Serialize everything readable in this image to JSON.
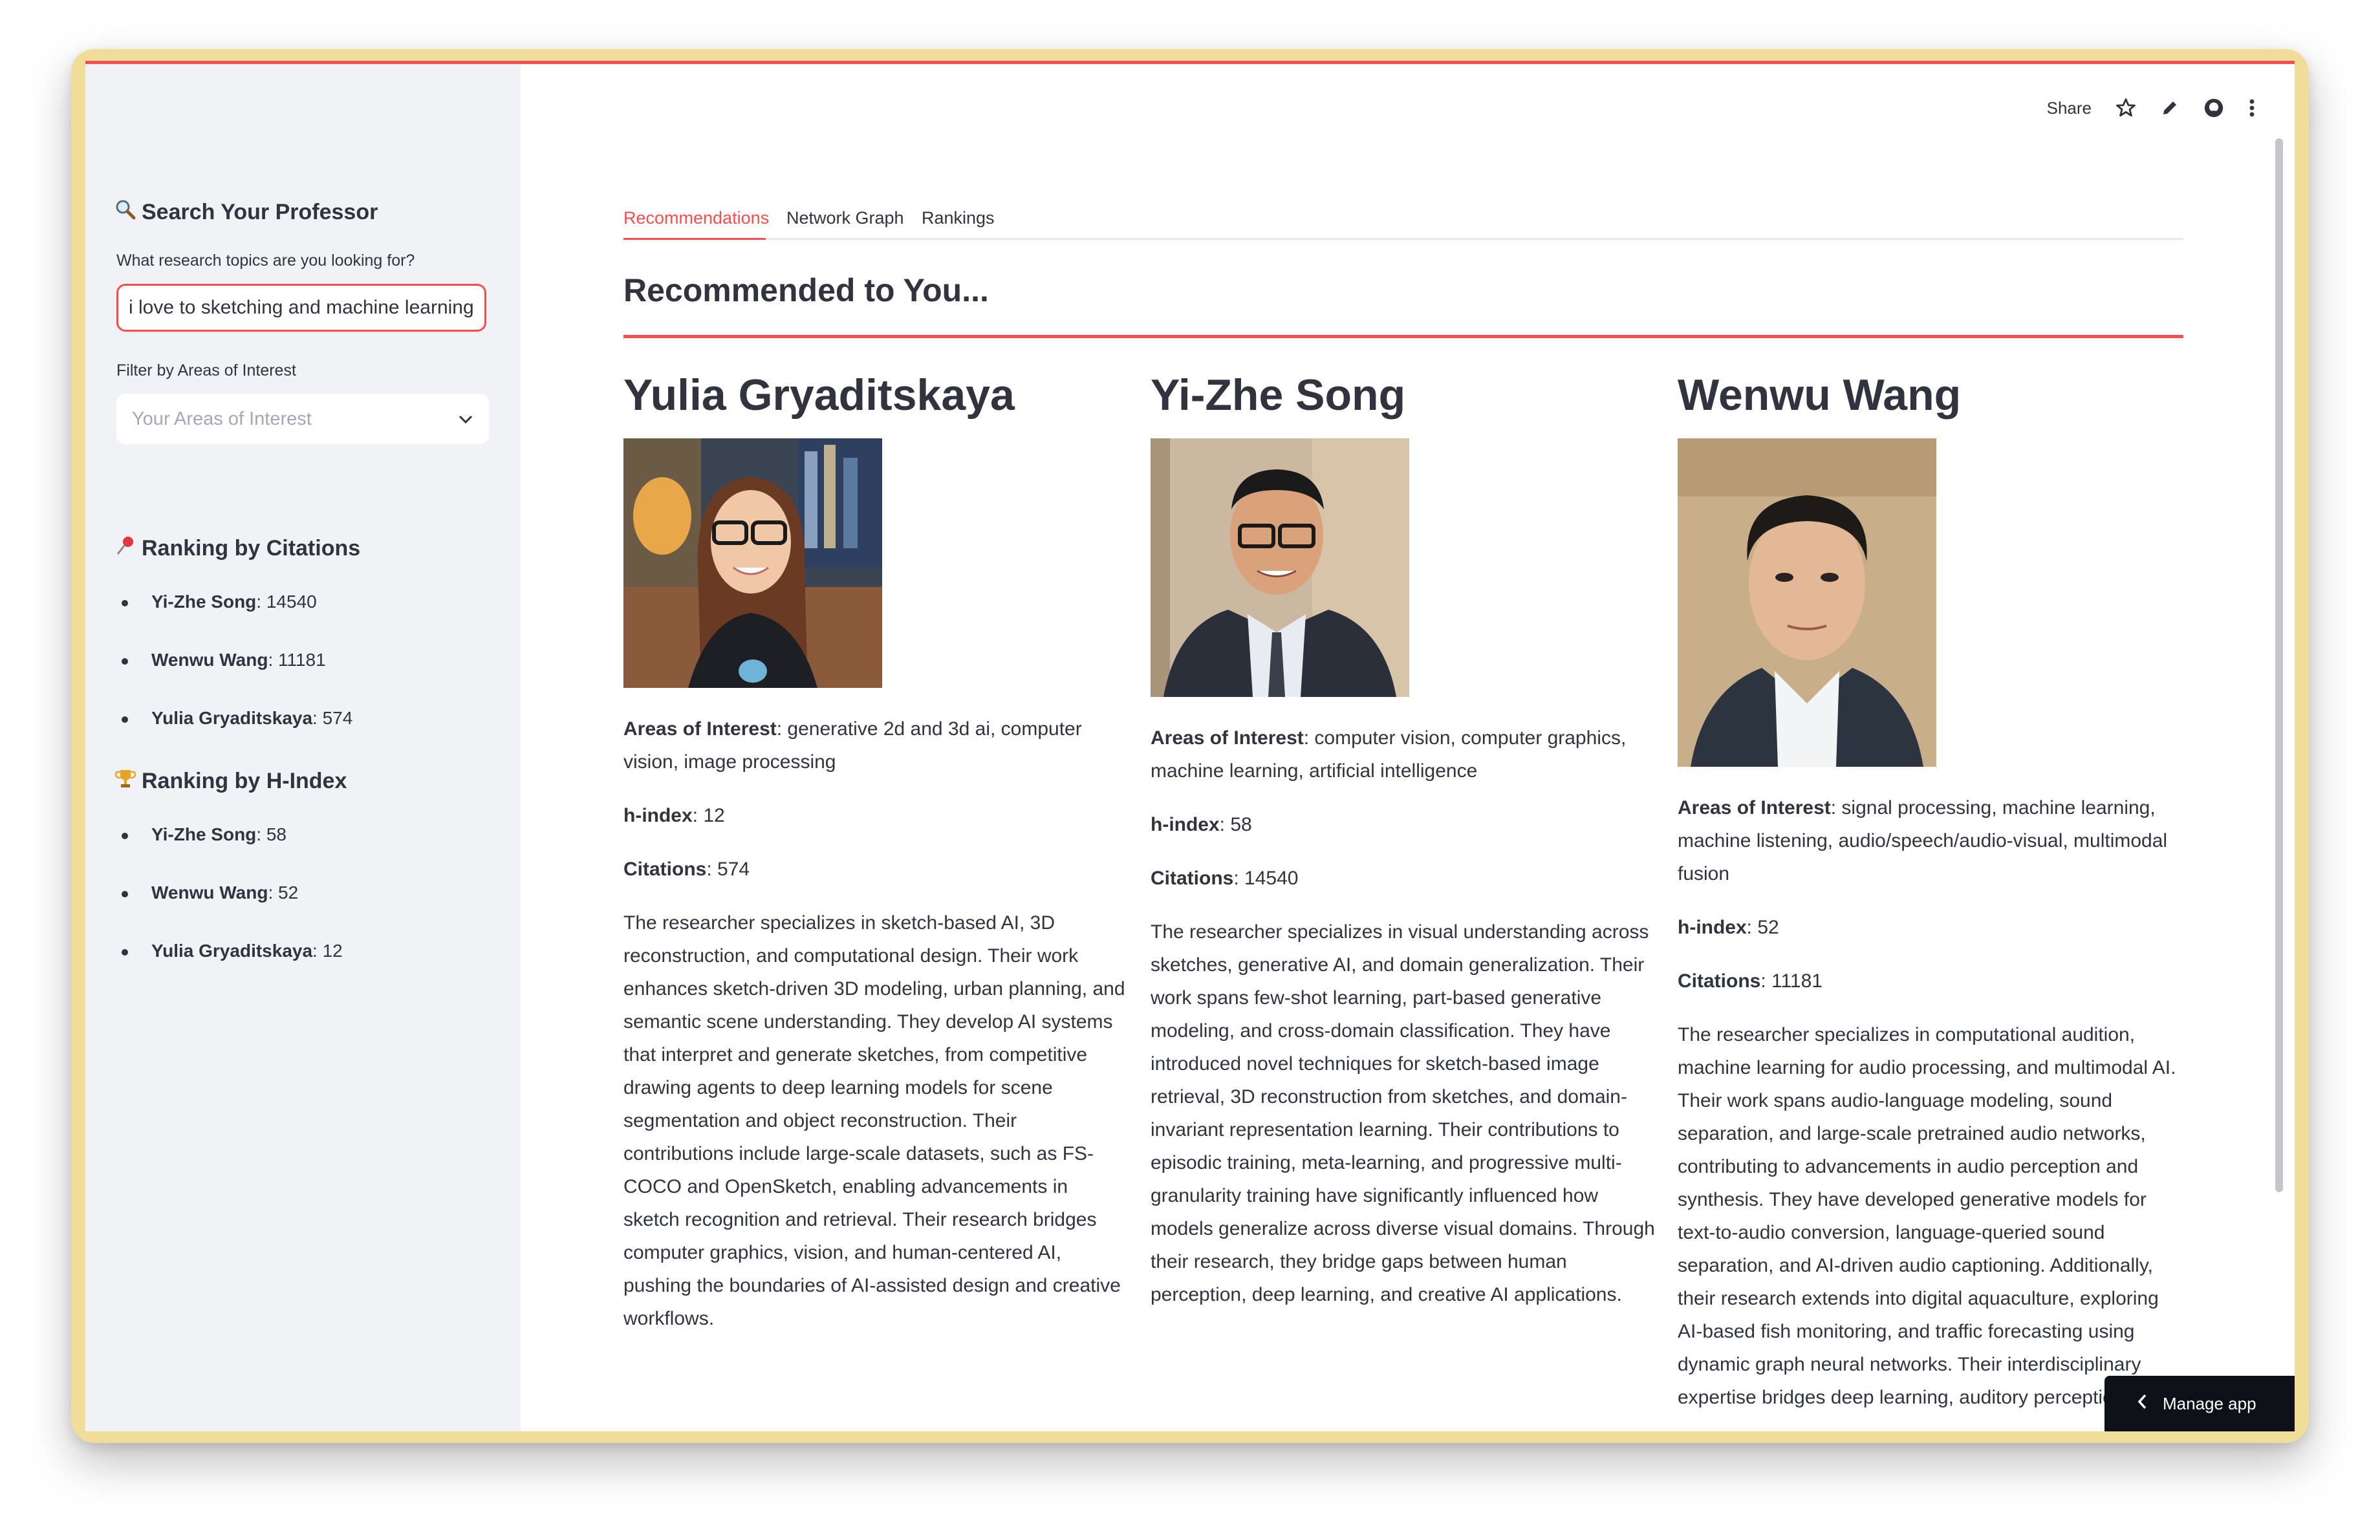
{
  "toolbar": {
    "share_label": "Share",
    "icons": [
      "star-icon",
      "pencil-icon",
      "github-icon",
      "more-vert-icon"
    ]
  },
  "sidebar": {
    "search_heading": {
      "icon": "magnifier-icon",
      "text": "Search Your Professor"
    },
    "search_label": "What research topics are you looking for?",
    "search_value": "i love to sketching and machine learning!",
    "filter_label": "Filter by Areas of Interest",
    "filter_placeholder": "Your Areas of Interest",
    "citations_heading": {
      "icon": "pushpin-icon",
      "text": "Ranking by Citations"
    },
    "citations": [
      {
        "name": "Yi-Zhe Song",
        "value": ": 14540"
      },
      {
        "name": "Wenwu Wang",
        "value": ": 11181"
      },
      {
        "name": "Yulia Gryaditskaya",
        "value": ": 574"
      }
    ],
    "hindex_heading": {
      "icon": "trophy-icon",
      "text": "Ranking by H-Index"
    },
    "hindex": [
      {
        "name": "Yi-Zhe Song",
        "value": ": 58"
      },
      {
        "name": "Wenwu Wang",
        "value": ": 52"
      },
      {
        "name": "Yulia Gryaditskaya",
        "value": ": 12"
      }
    ]
  },
  "tabs": [
    {
      "label": "Recommendations",
      "active": true
    },
    {
      "label": "Network Graph",
      "active": false
    },
    {
      "label": "Rankings",
      "active": false
    }
  ],
  "main": {
    "title": "Recommended to You...",
    "accent_color": "#ff4b4b",
    "professors": [
      {
        "name": "Yulia Gryaditskaya",
        "areas_label": "Areas of Interest",
        "areas": ": generative 2d and 3d ai, computer vision, image processing",
        "hindex_label": "h-index",
        "hindex": ": 12",
        "citations_label": "Citations",
        "citations": ": 574",
        "bio": "The researcher specializes in sketch-based AI, 3D reconstruction, and computational design. Their work enhances sketch-driven 3D modeling, urban planning, and semantic scene understanding. They develop AI systems that interpret and generate sketches, from competitive drawing agents to deep learning models for scene segmentation and object reconstruction. Their contributions include large-scale datasets, such as FS-COCO and OpenSketch, enabling advancements in sketch recognition and retrieval. Their research bridges computer graphics, vision, and human-centered AI, pushing the boundaries of AI-assisted design and creative workflows."
      },
      {
        "name": "Yi-Zhe Song",
        "areas_label": "Areas of Interest",
        "areas": ": computer vision, computer graphics, machine learning, artificial intelligence",
        "hindex_label": "h-index",
        "hindex": ": 58",
        "citations_label": "Citations",
        "citations": ": 14540",
        "bio": "The researcher specializes in visual understanding across sketches, generative AI, and domain generalization. Their work spans few-shot learning, part-based generative modeling, and cross-domain classification. They have introduced novel techniques for sketch-based image retrieval, 3D reconstruction from sketches, and domain-invariant representation learning. Their contributions to episodic training, meta-learning, and progressive multi-granularity training have significantly influenced how models generalize across diverse visual domains. Through their research, they bridge gaps between human perception, deep learning, and creative AI applications."
      },
      {
        "name": "Wenwu Wang",
        "areas_label": "Areas of Interest",
        "areas": ": signal processing, machine learning, machine listening, audio/speech/audio-visual, multimodal fusion",
        "hindex_label": "h-index",
        "hindex": ": 52",
        "citations_label": "Citations",
        "citations": ": 11181",
        "bio": "The researcher specializes in computational audition, machine learning for audio processing, and multimodal AI. Their work spans audio-language modeling, sound separation, and large-scale pretrained audio networks, contributing to advancements in audio perception and synthesis. They have developed generative models for text-to-audio conversion, language-queried sound separation, and AI-driven audio captioning. Additionally, their research extends into digital aquaculture, exploring AI-based fish monitoring, and traffic forecasting using dynamic graph neural networks. Their interdisciplinary expertise bridges deep learning, auditory perception"
      }
    ]
  },
  "manage_app": {
    "icon": "chevron-left-icon",
    "label": "Manage app"
  }
}
